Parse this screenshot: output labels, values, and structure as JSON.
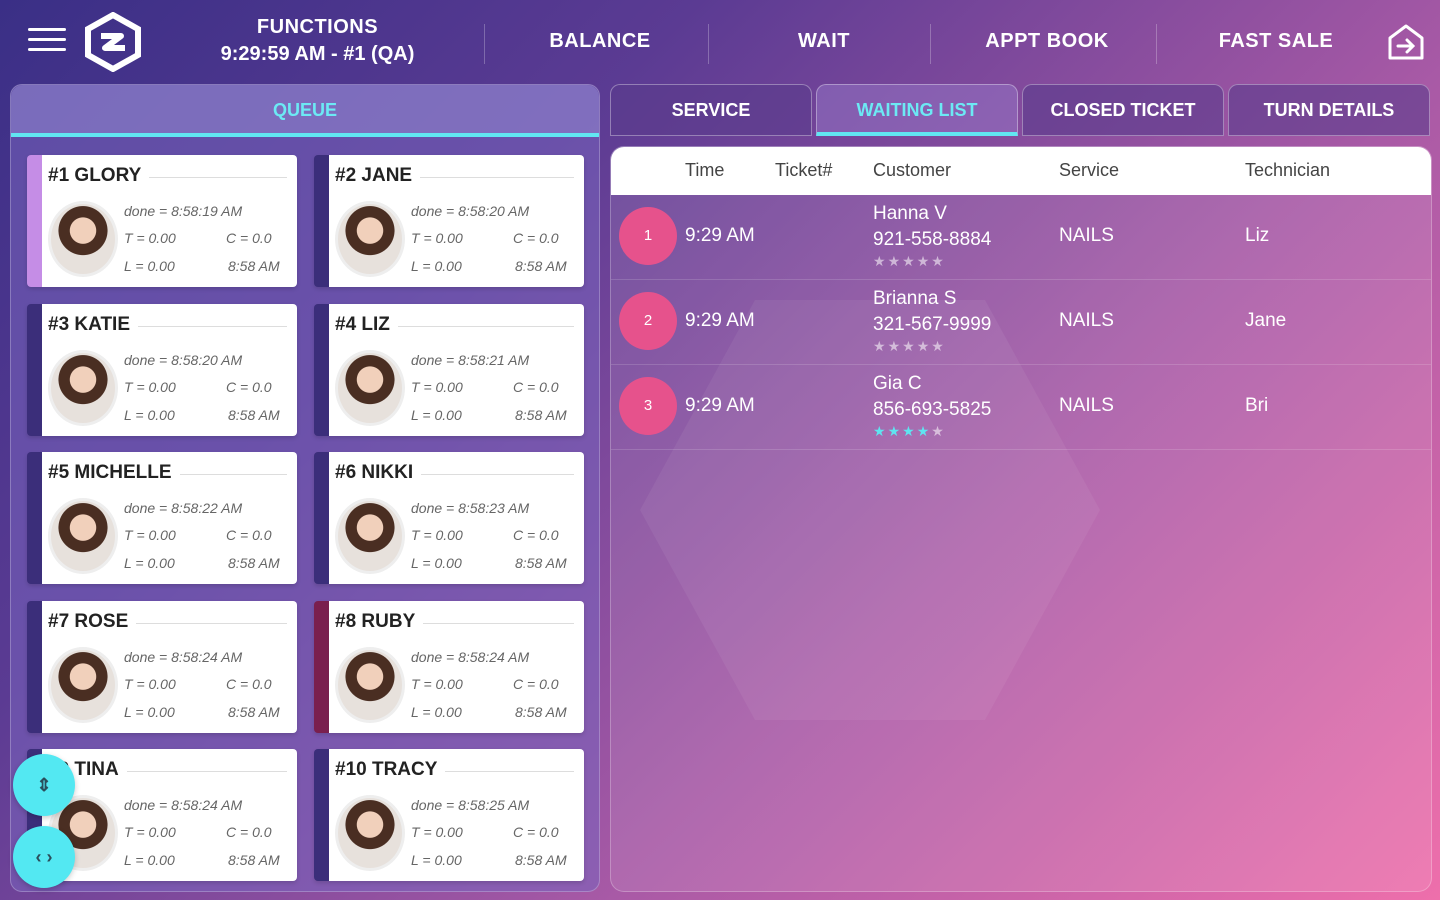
{
  "header": {
    "functions_label": "FUNCTIONS",
    "functions_sub": "9:29:59 AM - #1 (QA)",
    "nav": [
      "BALANCE",
      "WAIT",
      "APPT BOOK",
      "FAST SALE"
    ]
  },
  "queue": {
    "tab_label": "QUEUE",
    "technicians": [
      {
        "name": "#1 GLORY",
        "done": "done = 8:58:19 AM",
        "t": "T = 0.00",
        "c": "C = 0.0",
        "l": "L = 0.00",
        "time": "8:58 AM",
        "accent": "#c58de6"
      },
      {
        "name": "#2 JANE",
        "done": "done = 8:58:20 AM",
        "t": "T = 0.00",
        "c": "C = 0.0",
        "l": "L = 0.00",
        "time": "8:58 AM",
        "accent": "#3b2e7a"
      },
      {
        "name": "#3 KATIE",
        "done": "done = 8:58:20 AM",
        "t": "T = 0.00",
        "c": "C = 0.0",
        "l": "L = 0.00",
        "time": "8:58 AM",
        "accent": "#3b2e7a"
      },
      {
        "name": "#4 LIZ",
        "done": "done = 8:58:21 AM",
        "t": "T = 0.00",
        "c": "C = 0.0",
        "l": "L = 0.00",
        "time": "8:58 AM",
        "accent": "#3b2e7a"
      },
      {
        "name": "#5 MICHELLE",
        "done": "done = 8:58:22 AM",
        "t": "T = 0.00",
        "c": "C = 0.0",
        "l": "L = 0.00",
        "time": "8:58 AM",
        "accent": "#3b2e7a"
      },
      {
        "name": "#6 NIKKI",
        "done": "done = 8:58:23 AM",
        "t": "T = 0.00",
        "c": "C = 0.0",
        "l": "L = 0.00",
        "time": "8:58 AM",
        "accent": "#3b2e7a"
      },
      {
        "name": "#7 ROSE",
        "done": "done = 8:58:24 AM",
        "t": "T = 0.00",
        "c": "C = 0.0",
        "l": "L = 0.00",
        "time": "8:58 AM",
        "accent": "#3b2e7a"
      },
      {
        "name": "#8 RUBY",
        "done": "done = 8:58:24 AM",
        "t": "T = 0.00",
        "c": "C = 0.0",
        "l": "L = 0.00",
        "time": "8:58 AM",
        "accent": "#7a1f4e"
      },
      {
        "name": "#9 TINA",
        "done": "done = 8:58:24 AM",
        "t": "T = 0.00",
        "c": "C = 0.0",
        "l": "L = 0.00",
        "time": "8:58 AM",
        "accent": "#3b2e7a"
      },
      {
        "name": "#10 TRACY",
        "done": "done = 8:58:25 AM",
        "t": "T = 0.00",
        "c": "C = 0.0",
        "l": "L = 0.00",
        "time": "8:58 AM",
        "accent": "#3b2e7a"
      }
    ]
  },
  "tabs": [
    "SERVICE",
    "WAITING LIST",
    "CLOSED TICKET",
    "TURN DETAILS"
  ],
  "table": {
    "headers": [
      "Time",
      "Ticket#",
      "Customer",
      "Service",
      "Technician"
    ],
    "rows": [
      {
        "num": "1",
        "time": "9:29 AM",
        "customer": "Hanna V",
        "phone": "921-558-8884",
        "rating": 0,
        "service": "NAILS",
        "technician": "Liz"
      },
      {
        "num": "2",
        "time": "9:29 AM",
        "customer": "Brianna S",
        "phone": "321-567-9999",
        "rating": 0,
        "service": "NAILS",
        "technician": "Jane"
      },
      {
        "num": "3",
        "time": "9:29 AM",
        "customer": "Gia C",
        "phone": "856-693-5825",
        "rating": 4,
        "service": "NAILS",
        "technician": "Bri"
      }
    ]
  },
  "icons": {
    "menu": "hamburger-menu-icon",
    "logo": "app-logo",
    "logout": "logout-icon",
    "fab_vertical": "expand-vertical-icon",
    "fab_horizontal": "expand-horizontal-icon",
    "star": "star-icon"
  },
  "colors": {
    "accent": "#61e6f2",
    "badge": "#e6528c",
    "card_border": "#3b2e7a"
  }
}
